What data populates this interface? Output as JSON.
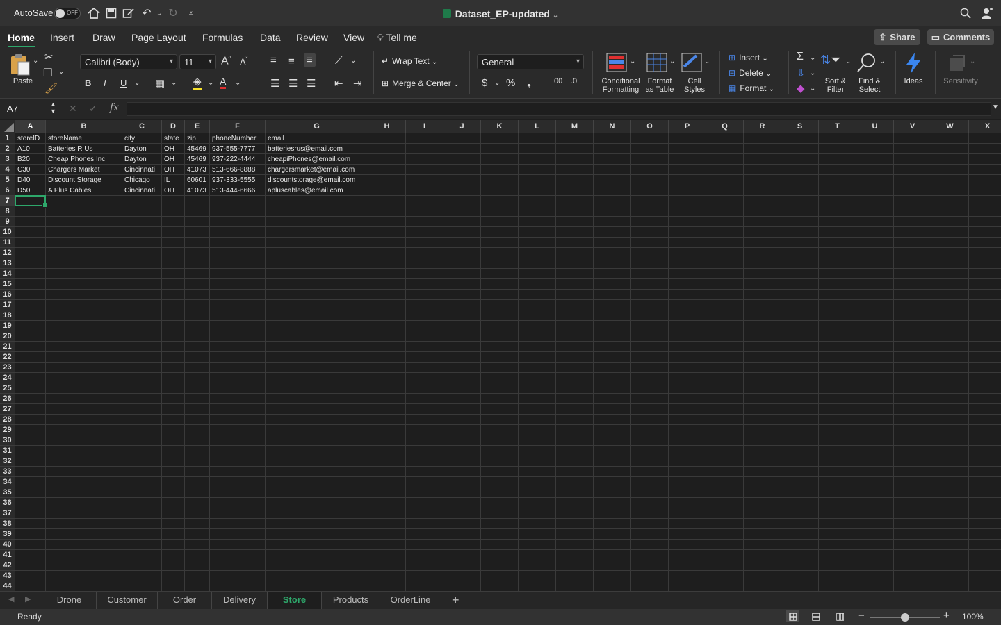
{
  "titlebar": {
    "autosave_label": "AutoSave",
    "autosave_state": "OFF",
    "document_title": "Dataset_EP-updated"
  },
  "ribbon_tabs": [
    "Home",
    "Insert",
    "Draw",
    "Page Layout",
    "Formulas",
    "Data",
    "Review",
    "View",
    "Tell me"
  ],
  "share_label": "Share",
  "comments_label": "Comments",
  "ribbon": {
    "paste": "Paste",
    "font_name": "Calibri (Body)",
    "font_size": "11",
    "wrap_text": "Wrap Text",
    "merge_center": "Merge & Center",
    "number_format": "General",
    "conditional_formatting": [
      "Conditional",
      "Formatting"
    ],
    "format_as_table": [
      "Format",
      "as Table"
    ],
    "cell_styles": [
      "Cell",
      "Styles"
    ],
    "insert": "Insert",
    "delete": "Delete",
    "format": "Format",
    "sort_filter": [
      "Sort &",
      "Filter"
    ],
    "find_select": [
      "Find &",
      "Select"
    ],
    "ideas": "Ideas",
    "sensitivity": "Sensitivity"
  },
  "formula_bar": {
    "name_box": "A7",
    "fx": "fx",
    "value": ""
  },
  "columns": [
    "A",
    "B",
    "C",
    "D",
    "E",
    "F",
    "G",
    "H",
    "I",
    "J",
    "K",
    "L",
    "M",
    "N",
    "O",
    "P",
    "Q",
    "R",
    "S",
    "T",
    "U",
    "V",
    "W",
    "X"
  ],
  "row_count": 44,
  "selected_cell": "A7",
  "table": {
    "header": [
      "storeID",
      "storeName",
      "city",
      "state",
      "zip",
      "phoneNumber",
      "email"
    ],
    "rows": [
      [
        "A10",
        "Batteries R Us",
        "Dayton",
        "OH",
        "45469",
        "937-555-7777",
        "batteriesrus@email.com"
      ],
      [
        "B20",
        " Cheap Phones Inc",
        "Dayton",
        "OH",
        "45469",
        "937-222-4444",
        "cheapiPhones@email.com"
      ],
      [
        "C30",
        "Chargers Market",
        "Cincinnati",
        "OH",
        "41073",
        "513-666-8888",
        "chargersmarket@email.com"
      ],
      [
        "D40",
        "Discount Storage",
        "Chicago",
        "IL",
        "60601",
        "937-333-5555",
        "discountstorage@email.com"
      ],
      [
        "D50",
        "A Plus Cables",
        "Cincinnati",
        "OH",
        "41073",
        "513-444-6666",
        "apluscables@email.com"
      ]
    ]
  },
  "sheet_tabs": [
    "Drone",
    "Customer",
    "Order",
    "Delivery",
    "Store",
    "Products",
    "OrderLine"
  ],
  "active_sheet": "Store",
  "status": {
    "text": "Ready",
    "zoom": "100%",
    "zoom_level_percent": 100
  },
  "colors": {
    "accent": "#2ea86b",
    "background": "#1e1e1e"
  }
}
